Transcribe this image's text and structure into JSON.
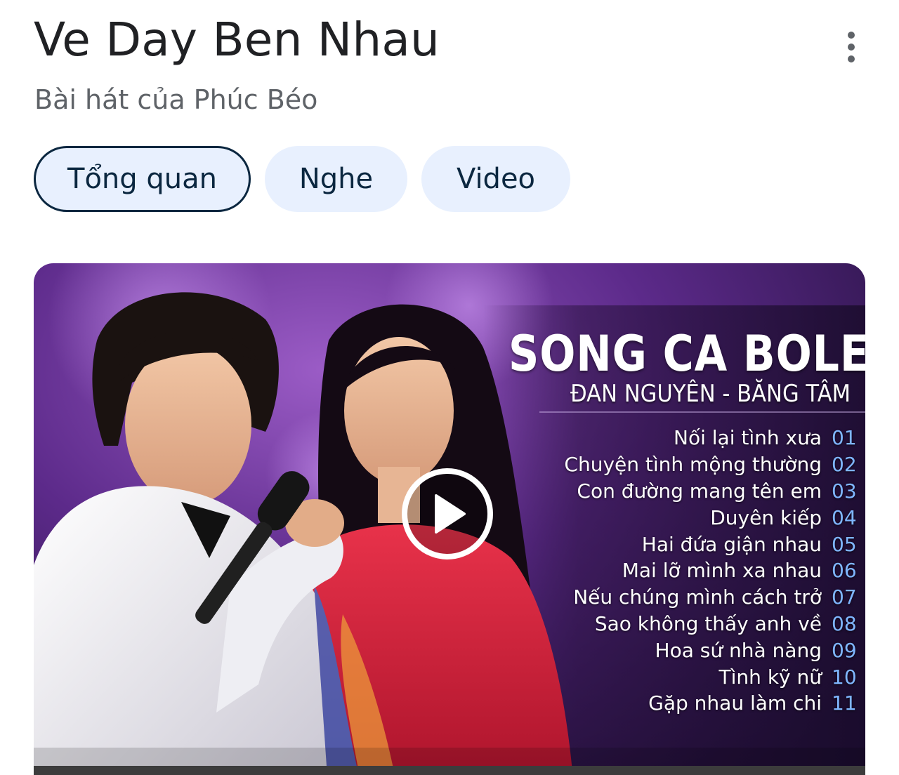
{
  "header": {
    "title": "Ve Day Ben Nhau",
    "subtitle": "Bài hát của Phúc Béo",
    "more_icon": "more-vert-icon"
  },
  "tabs": [
    {
      "label": "Tổng quan",
      "active": true
    },
    {
      "label": "Nghe",
      "active": false
    },
    {
      "label": "Video",
      "active": false
    }
  ],
  "video": {
    "headline": "SONG CA BOLERO",
    "artists": "ĐAN NGUYÊN - BĂNG TÂM",
    "play_icon": "play-circle-icon",
    "tracks": [
      {
        "name": "Nối lại tình xưa",
        "num": "01"
      },
      {
        "name": "Chuyện tình mộng thường",
        "num": "02"
      },
      {
        "name": "Con đường mang tên em",
        "num": "03"
      },
      {
        "name": "Duyên kiếp",
        "num": "04"
      },
      {
        "name": "Hai đứa giận nhau",
        "num": "05"
      },
      {
        "name": "Mai lỡ mình xa nhau",
        "num": "06"
      },
      {
        "name": "Nếu chúng mình cách trở",
        "num": "07"
      },
      {
        "name": "Sao không thấy anh về",
        "num": "08"
      },
      {
        "name": "Hoa sứ nhà nàng",
        "num": "09"
      },
      {
        "name": "Tình kỹ nữ",
        "num": "10"
      },
      {
        "name": "Gặp nhau làm chi",
        "num": "11"
      }
    ]
  },
  "colors": {
    "tab_bg": "#e8f0fe",
    "tab_text": "#0b2740",
    "track_number": "#7fb6ff"
  }
}
